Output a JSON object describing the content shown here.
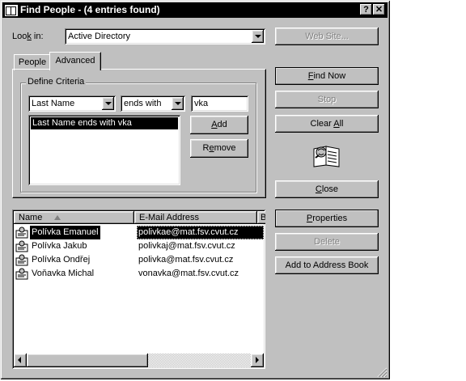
{
  "window": {
    "title": "Find People - (4 entries found)",
    "help_glyph": "?",
    "close_glyph": "✕"
  },
  "lookin": {
    "label_prefix": "Loo",
    "label_accel": "k",
    "label_suffix": " in:",
    "value": "Active Directory"
  },
  "buttons": {
    "website": "Web Site...",
    "find_now_accel": "F",
    "find_now_rest": "ind Now",
    "stop": "Stop",
    "clear_all_pre": "Clear ",
    "clear_all_accel": "A",
    "clear_all_rest": "ll",
    "close_accel": "C",
    "close_rest": "lose",
    "properties_accel": "P",
    "properties_rest": "roperties",
    "delete": "Delete",
    "add_to_address_book": "Add to Address Book"
  },
  "tabs": {
    "people": "People",
    "advanced": "Advanced"
  },
  "criteria": {
    "group_label": "Define Criteria",
    "field": "Last Name",
    "operator": "ends with",
    "value": "vka",
    "add_accel": "A",
    "add_rest": "dd",
    "remove_pre": "R",
    "remove_accel": "e",
    "remove_rest": "move",
    "items": [
      "Last Name ends with vka"
    ]
  },
  "results": {
    "columns": [
      "Name",
      "E-Mail Address",
      "B"
    ],
    "rows": [
      {
        "name": "Polívka Emanuel",
        "email": "polivkae@mat.fsv.cvut.cz",
        "selected": true
      },
      {
        "name": "Polívka Jakub",
        "email": "polivkaj@mat.fsv.cvut.cz",
        "selected": false
      },
      {
        "name": "Polívka Ondřej",
        "email": "polivka@mat.fsv.cvut.cz",
        "selected": false
      },
      {
        "name": "Voňavka Michal",
        "email": "vonavka@mat.fsv.cvut.cz",
        "selected": false
      }
    ]
  },
  "colors": {
    "face": "#c0c0c0",
    "title_bar": "#000000",
    "selection": "#000000"
  }
}
